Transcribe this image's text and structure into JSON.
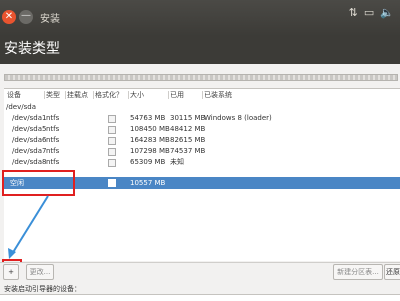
{
  "window": {
    "title": "安装",
    "close_glyph": "✕",
    "minimize_glyph": "—"
  },
  "tray": {
    "icons": [
      "network-icon",
      "battery-icon",
      "volume-icon"
    ]
  },
  "header": {
    "title": "安装类型"
  },
  "table": {
    "columns": [
      "设备",
      "类型",
      "挂载点",
      "格式化？",
      "大小",
      "已用",
      "已装系统"
    ],
    "disk": "/dev/sda",
    "rows": [
      {
        "device": "/dev/sda1",
        "type": "ntfs",
        "mount": "",
        "size": "54763 MB",
        "used": "30115 MB",
        "system": "Windows 8 (loader)"
      },
      {
        "device": "/dev/sda5",
        "type": "ntfs",
        "mount": "",
        "size": "108450 MB",
        "used": "48412 MB",
        "system": ""
      },
      {
        "device": "/dev/sda6",
        "type": "ntfs",
        "mount": "",
        "size": "164283 MB",
        "used": "82615 MB",
        "system": ""
      },
      {
        "device": "/dev/sda7",
        "type": "ntfs",
        "mount": "",
        "size": "107298 MB",
        "used": "74537 MB",
        "system": ""
      },
      {
        "device": "/dev/sda8",
        "type": "ntfs",
        "mount": "",
        "size": "65309 MB",
        "used": "未知",
        "system": ""
      }
    ],
    "free_row": {
      "device": "空闲",
      "size": "10557 MB"
    }
  },
  "toolbar": {
    "add_label": "+",
    "change_label": "更改...",
    "new_table_label": "新建分区表...",
    "revert_label": "还原"
  },
  "bootloader": {
    "label": "安装启动引导器的设备："
  },
  "colors": {
    "selection": "#4a86c5",
    "annotation": "#e02020",
    "arrow": "#3a8fd8"
  }
}
